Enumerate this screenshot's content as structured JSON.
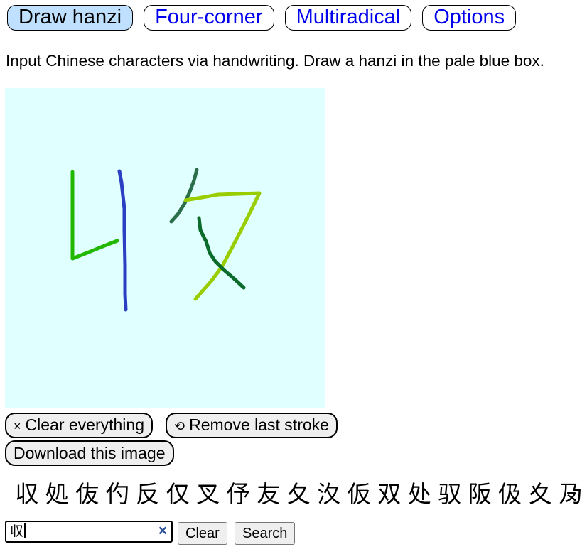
{
  "tabs": [
    {
      "label": "Draw hanzi",
      "active": true
    },
    {
      "label": "Four-corner",
      "active": false
    },
    {
      "label": "Multiradical",
      "active": false
    },
    {
      "label": "Options",
      "active": false
    }
  ],
  "intro": "Input Chinese characters via handwriting. Draw a hanzi in the pale blue box.",
  "canvas": {
    "background": "#e0ffff",
    "stroke_colors": [
      "#22b800",
      "#2a3fc2",
      "#2b6e4a",
      "#9acd00",
      "#0a6b2a"
    ]
  },
  "actions": {
    "clear_everything": {
      "icon": "×",
      "label": "Clear everything"
    },
    "remove_last_stroke": {
      "icon": "⟲",
      "label": "Remove last stroke"
    },
    "download": {
      "label": "Download this image"
    }
  },
  "candidates": [
    "収",
    "処",
    "伖",
    "仢",
    "反",
    "仅",
    "叉",
    "伃",
    "友",
    "夂",
    "汷",
    "仮",
    "双",
    "处",
    "驭",
    "阪",
    "伋",
    "夊",
    "夃"
  ],
  "search": {
    "value": "収",
    "clear_icon": "×"
  },
  "buttons": {
    "clear": "Clear",
    "search": "Search"
  }
}
